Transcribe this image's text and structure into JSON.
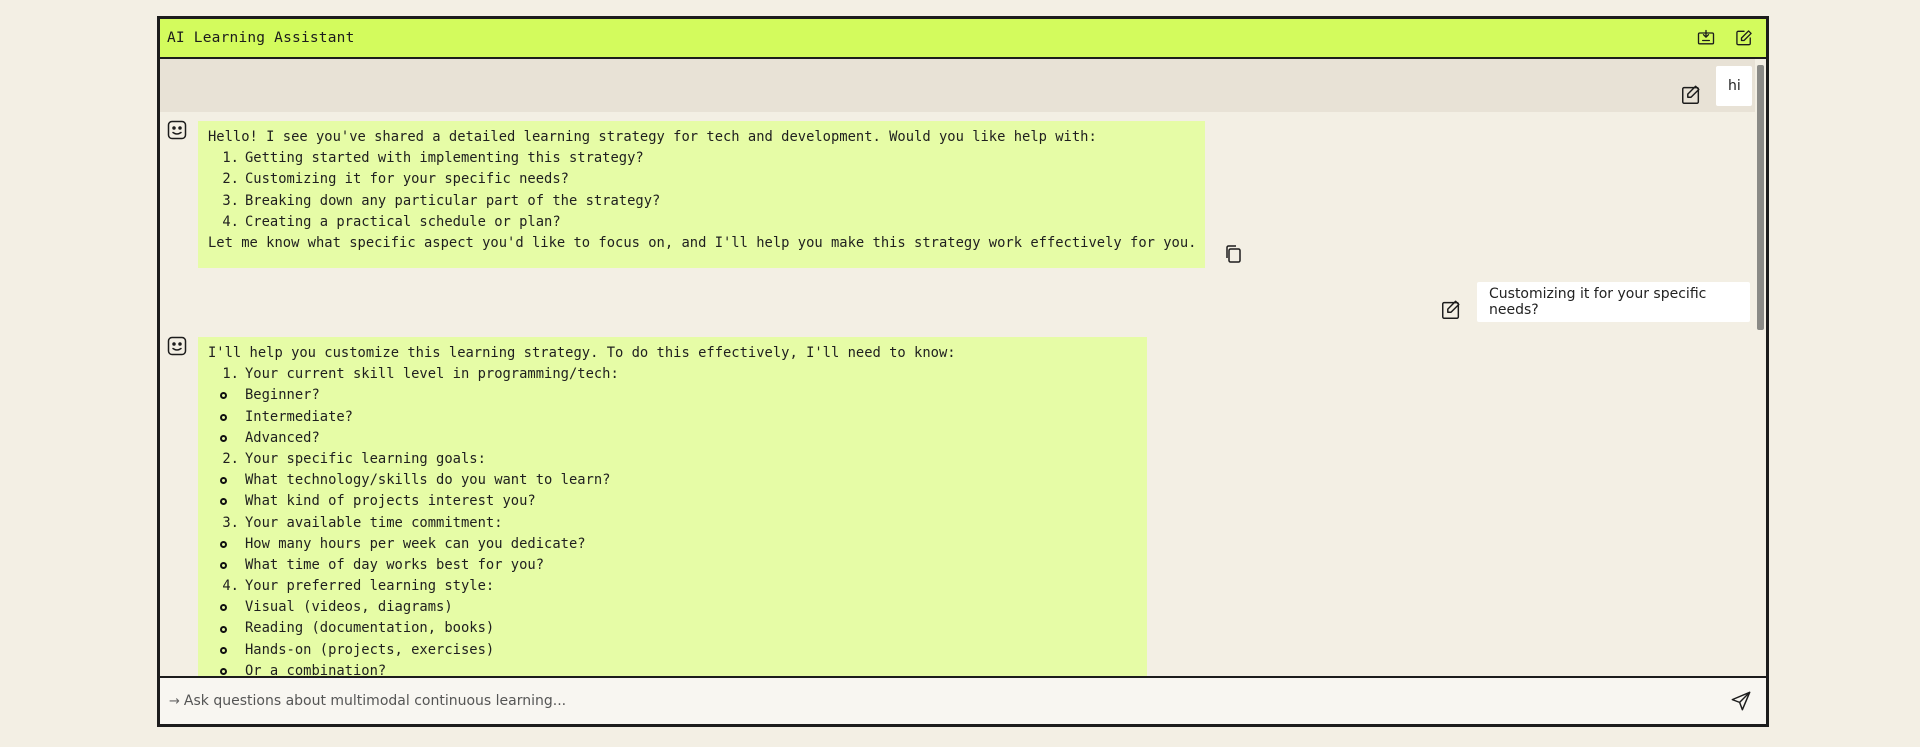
{
  "app": {
    "title": "AI Learning Assistant"
  },
  "header": {
    "icons": [
      "download-tray-icon",
      "new-chat-edit-icon"
    ]
  },
  "messages": [
    {
      "role": "user",
      "text": "hi"
    },
    {
      "role": "assistant",
      "lines": [
        {
          "kind": "text",
          "text": "Hello! I see you've shared a detailed learning strategy for tech and development. Would you like help with:"
        },
        {
          "kind": "ol",
          "num": "1.",
          "text": "Getting started with implementing this strategy?"
        },
        {
          "kind": "ol",
          "num": "2.",
          "text": "Customizing it for your specific needs?"
        },
        {
          "kind": "ol",
          "num": "3.",
          "text": "Breaking down any particular part of the strategy?"
        },
        {
          "kind": "ol",
          "num": "4.",
          "text": "Creating a practical schedule or plan?"
        },
        {
          "kind": "text",
          "text": "Let me know what specific aspect you'd like to focus on, and I'll help you make this strategy work effectively for you."
        }
      ]
    },
    {
      "role": "user",
      "text": "Customizing it for your specific needs?"
    },
    {
      "role": "assistant",
      "lines": [
        {
          "kind": "text",
          "text": "I'll help you customize this learning strategy. To do this effectively, I'll need to know:"
        },
        {
          "kind": "ol",
          "num": "1.",
          "text": "Your current skill level in programming/tech:"
        },
        {
          "kind": "ul",
          "text": "Beginner?"
        },
        {
          "kind": "ul",
          "text": "Intermediate?"
        },
        {
          "kind": "ul",
          "text": "Advanced?"
        },
        {
          "kind": "ol",
          "num": "2.",
          "text": "Your specific learning goals:"
        },
        {
          "kind": "ul",
          "text": "What technology/skills do you want to learn?"
        },
        {
          "kind": "ul",
          "text": "What kind of projects interest you?"
        },
        {
          "kind": "ol",
          "num": "3.",
          "text": "Your available time commitment:"
        },
        {
          "kind": "ul",
          "text": "How many hours per week can you dedicate?"
        },
        {
          "kind": "ul",
          "text": "What time of day works best for you?"
        },
        {
          "kind": "ol",
          "num": "4.",
          "text": "Your preferred learning style:"
        },
        {
          "kind": "ul",
          "text": "Visual (videos, diagrams)"
        },
        {
          "kind": "ul",
          "text": "Reading (documentation, books)"
        },
        {
          "kind": "ul",
          "text": "Hands-on (projects, exercises)"
        },
        {
          "kind": "ul",
          "text": "Or a combination?"
        }
      ]
    }
  ],
  "input": {
    "arrow": "→",
    "placeholder": "Ask questions about multimodal continuous learning...",
    "value": ""
  },
  "colors": {
    "accent": "#d3fb5d",
    "assistant_bubble": "#e6fca6",
    "background": "#f3efe4",
    "band": "#e8e2d6"
  }
}
